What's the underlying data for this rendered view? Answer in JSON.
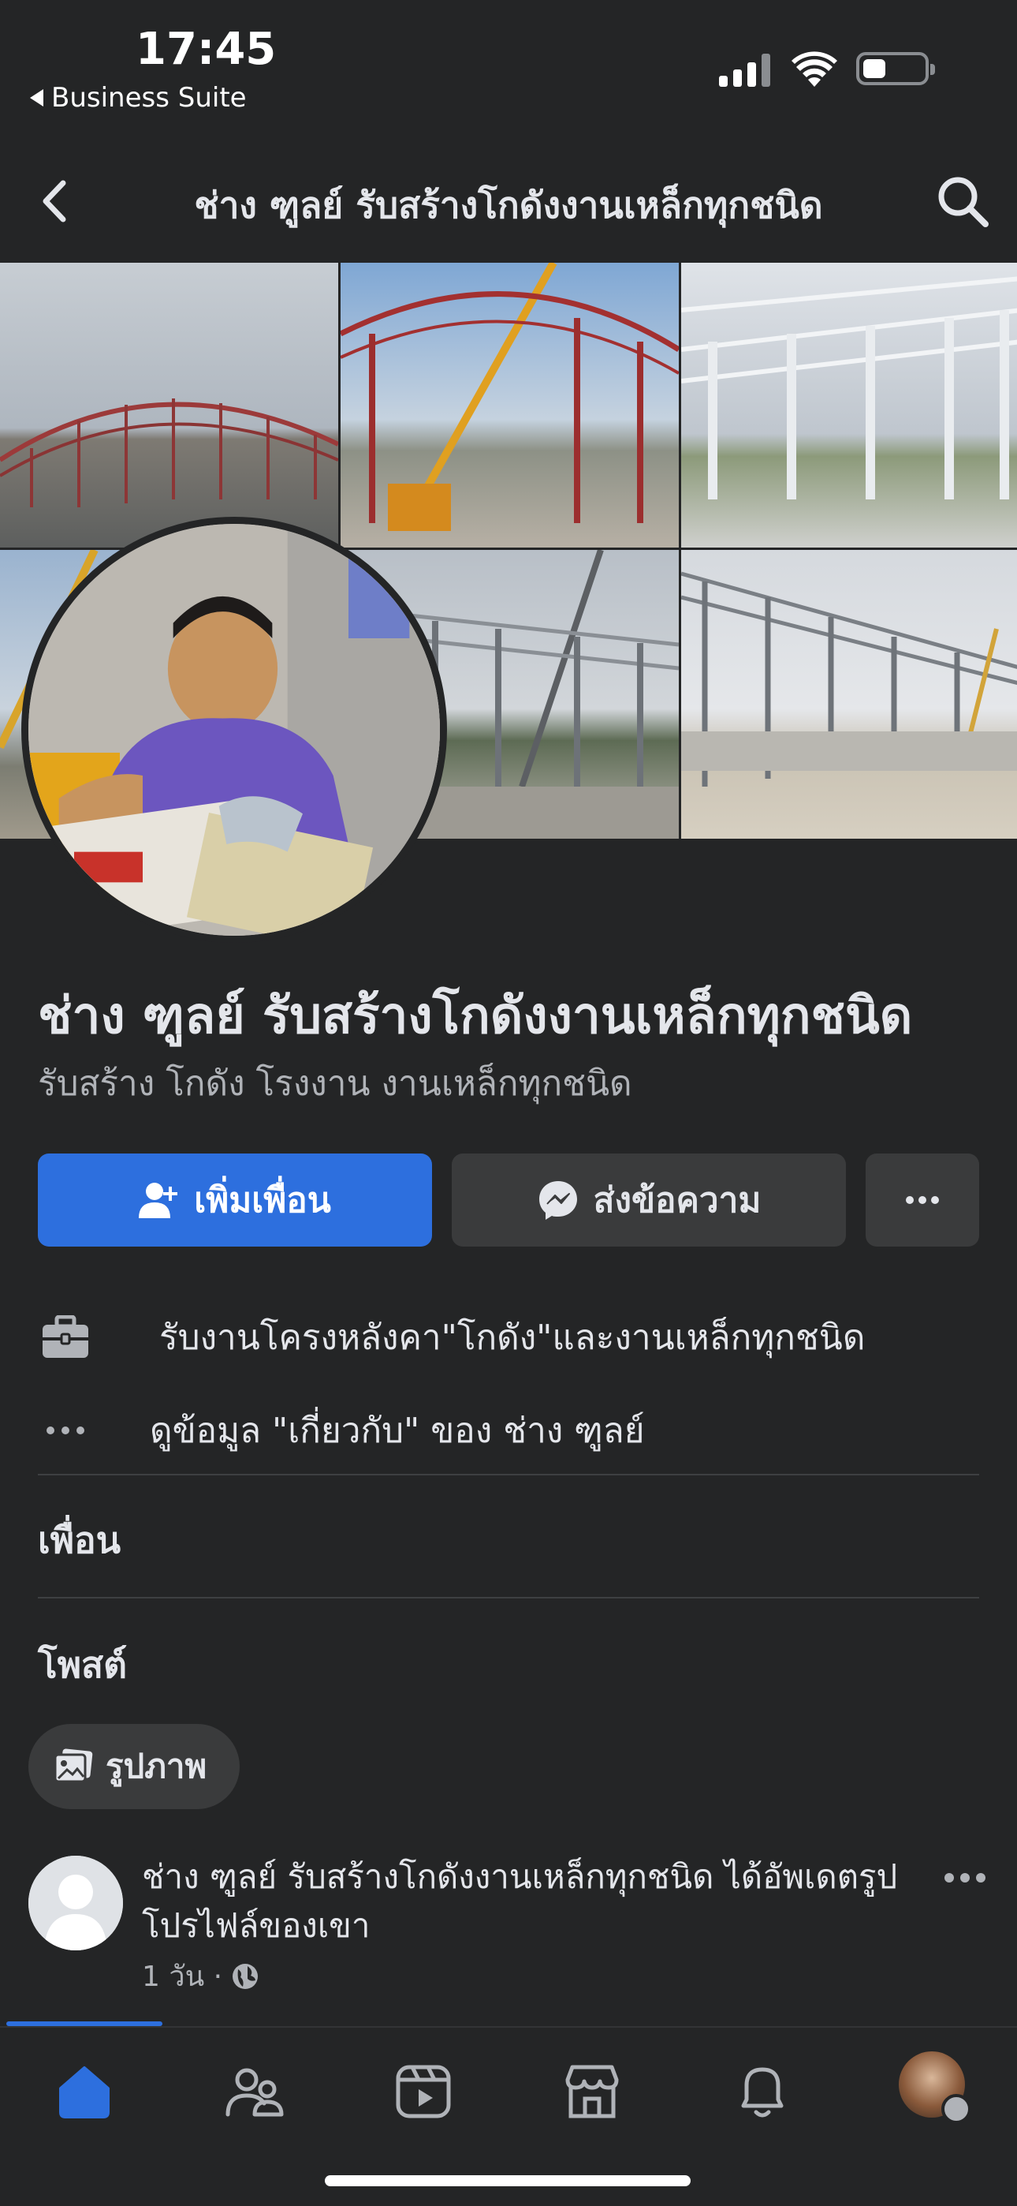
{
  "status_bar": {
    "time": "17:45",
    "back_app": "Business Suite"
  },
  "header": {
    "title": "ช่าง ฑูลย์ รับสร้างโกดังงานเหล็กทุกชนิด"
  },
  "profile": {
    "name": "ช่าง ฑูลย์ รับสร้างโกดังงานเหล็กทุกชนิด",
    "category": "รับสร้าง โกดัง โรงงาน งานเหล็กทุกชนิด"
  },
  "actions": {
    "add_friend": "เพิ่มเพื่อน",
    "message": "ส่งข้อความ",
    "more": "more-icon"
  },
  "details": {
    "work": "รับงานโครงหลังคา\"โกดัง\"และงานเหล็กทุกชนิด",
    "about": "ดูข้อมูล \"เกี่ยวกับ\" ของ ช่าง ฑูลย์"
  },
  "sections": {
    "friends": "เพื่อน",
    "posts": "โพสต์"
  },
  "filters": {
    "photos": "รูปภาพ"
  },
  "post": {
    "text": "ช่าง ฑูลย์ รับสร้างโกดังงานเหล็กทุกชนิด ได้อัพเดตรูปโปรไฟล์ของเขา",
    "time": "1 วัน ·"
  },
  "tabs": [
    {
      "name": "home",
      "icon": "home-icon",
      "active": true
    },
    {
      "name": "friends",
      "icon": "friends-icon",
      "active": false
    },
    {
      "name": "watch",
      "icon": "video-icon",
      "active": false
    },
    {
      "name": "marketplace",
      "icon": "marketplace-icon",
      "active": false
    },
    {
      "name": "notifications",
      "icon": "bell-icon",
      "active": false
    },
    {
      "name": "profile-menu",
      "icon": "avatar-menu-icon",
      "active": false
    }
  ],
  "colors": {
    "background": "#242526",
    "primary": "#2d6fde",
    "button_secondary": "#3a3b3c",
    "text_primary": "#e4e6eb",
    "text_secondary": "#b0b3b8"
  }
}
